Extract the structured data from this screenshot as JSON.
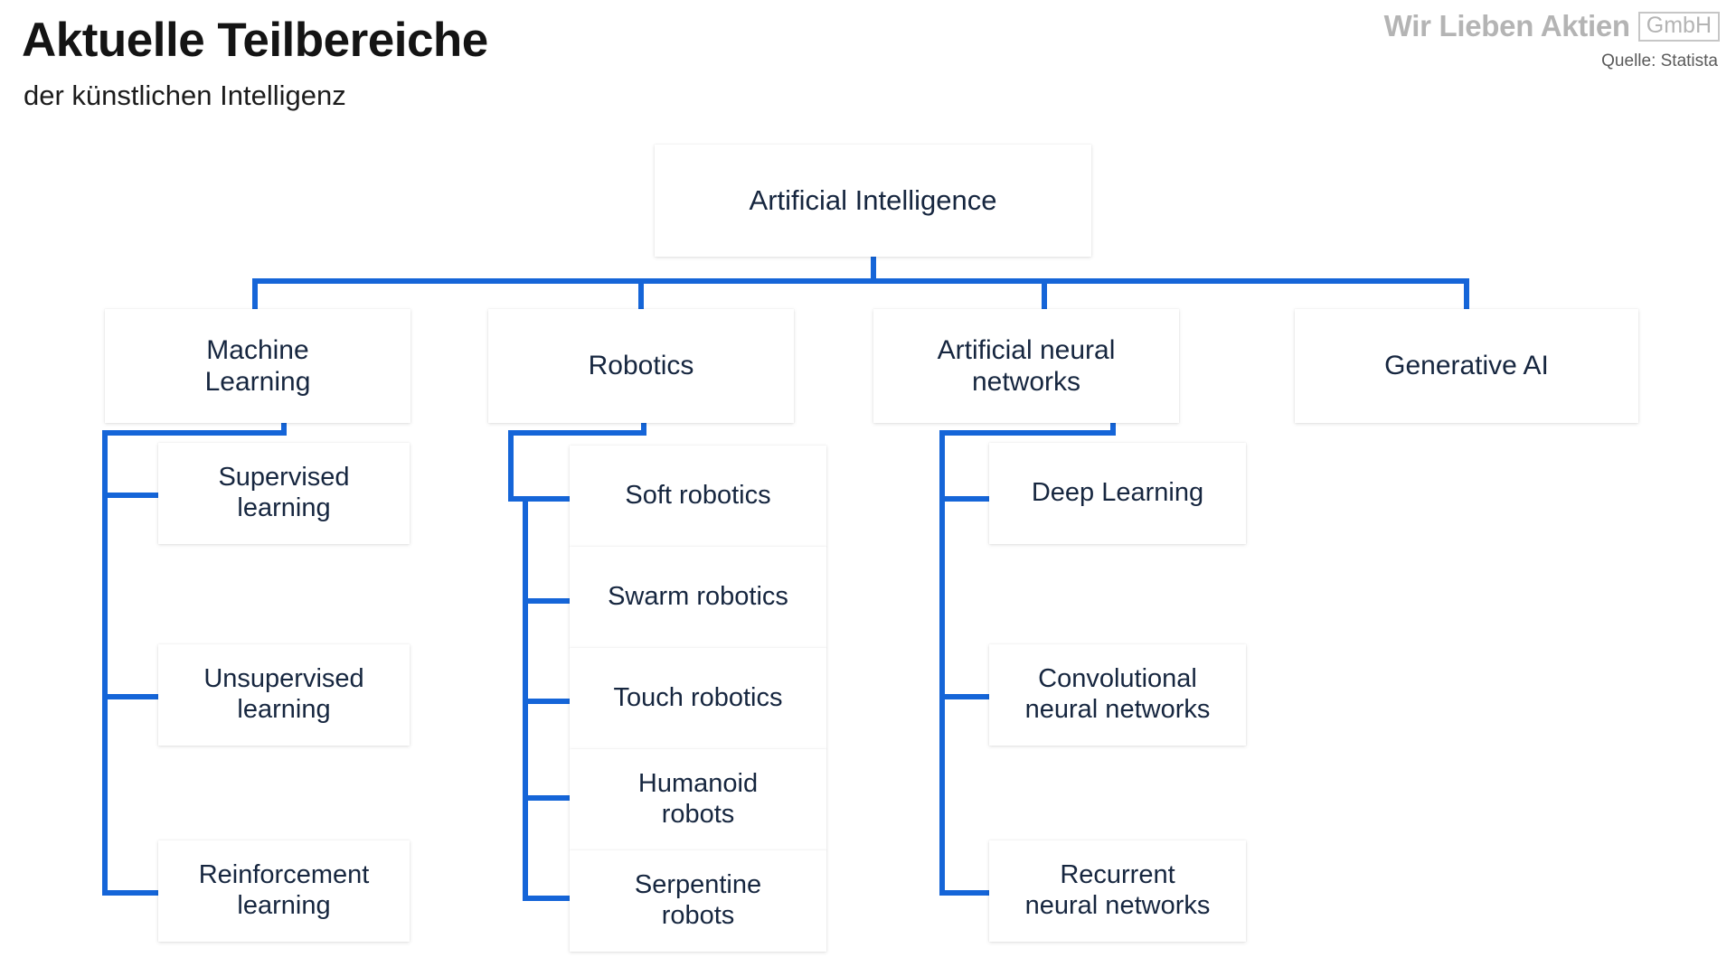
{
  "header": {
    "title": "Aktuelle Teilbereiche",
    "subtitle": "der künstlichen Intelligenz",
    "brand_name": "Wir Lieben Aktien",
    "brand_suffix": "GmbH",
    "source": "Quelle: Statista"
  },
  "theme": {
    "connector_color": "#1565d8",
    "node_text_color": "#16263f",
    "node_background": "#ffffff",
    "page_background": "#ffffff",
    "brand_color": "#b4b4b4"
  },
  "chart_data": {
    "type": "tree",
    "title": "Aktuelle Teilbereiche der künstlichen Intelligenz",
    "root": "Artificial Intelligence",
    "nodes": [
      {
        "label": "Artificial Intelligence",
        "level": 1,
        "children": [
          {
            "label": "Machine Learning",
            "level": 2,
            "children": [
              {
                "label": "Supervised learning",
                "level": 3
              },
              {
                "label": "Unsupervised learning",
                "level": 3
              },
              {
                "label": "Reinforcement learning",
                "level": 3
              }
            ]
          },
          {
            "label": "Robotics",
            "level": 2,
            "children": [
              {
                "label": "Soft robotics",
                "level": 3
              },
              {
                "label": "Swarm robotics",
                "level": 3
              },
              {
                "label": "Touch robotics",
                "level": 3
              },
              {
                "label": "Humanoid robots",
                "level": 3
              },
              {
                "label": "Serpentine robots",
                "level": 3
              }
            ]
          },
          {
            "label": "Artificial neural networks",
            "level": 2,
            "children": [
              {
                "label": "Deep Learning",
                "level": 3
              },
              {
                "label": "Convolutional neural networks",
                "level": 3
              },
              {
                "label": "Recurrent neural networks",
                "level": 3
              }
            ]
          },
          {
            "label": "Generative AI",
            "level": 2,
            "children": []
          }
        ]
      }
    ]
  },
  "tree": {
    "root": {
      "text": "Artificial Intelligence"
    },
    "branches": [
      {
        "text": "Machine\nLearning"
      },
      {
        "text": "Robotics"
      },
      {
        "text": "Artificial neural\nnetworks"
      },
      {
        "text": "Generative AI"
      }
    ],
    "ml_children": [
      {
        "text": "Supervised\nlearning"
      },
      {
        "text": "Unsupervised\nlearning"
      },
      {
        "text": "Reinforcement\nlearning"
      }
    ],
    "robotics_children": [
      {
        "text": "Soft robotics"
      },
      {
        "text": "Swarm robotics"
      },
      {
        "text": "Touch robotics"
      },
      {
        "text": "Humanoid\nrobots"
      },
      {
        "text": "Serpentine\nrobots"
      }
    ],
    "ann_children": [
      {
        "text": "Deep Learning"
      },
      {
        "text": "Convolutional\nneural networks"
      },
      {
        "text": "Recurrent\nneural networks"
      }
    ]
  }
}
